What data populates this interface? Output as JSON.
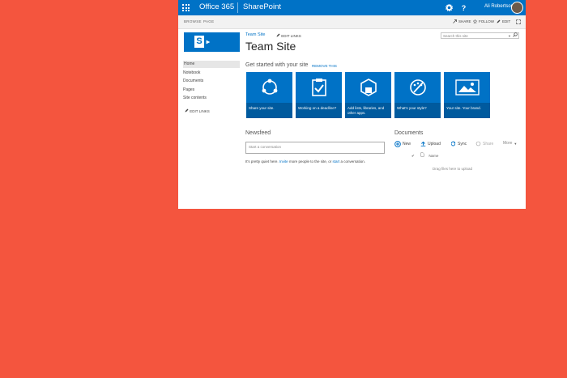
{
  "topbar": {
    "brand": "Office 365",
    "app": "SharePoint",
    "settings_icon": "gear-icon",
    "help_label": "?",
    "user_name": "Ali Robertson"
  },
  "ribbon": {
    "tabs": [
      "BROWSE",
      "PAGE"
    ],
    "share": "SHARE",
    "follow": "FOLLOW",
    "edit": "EDIT"
  },
  "site": {
    "logo_letter": "S",
    "breadcrumb": "Team Site",
    "edit_links": "EDIT LINKS",
    "title": "Team Site",
    "search_placeholder": "Search this site"
  },
  "nav": {
    "items": [
      "Home",
      "Notebook",
      "Documents",
      "Pages",
      "Site contents"
    ],
    "edit_links": "EDIT LINKS"
  },
  "getting_started": {
    "title": "Get started with your site",
    "remove": "REMOVE THIS",
    "tiles": [
      {
        "caption": "Share your site.",
        "icon": "share-icon"
      },
      {
        "caption": "Working on a deadline?",
        "icon": "clipboard-check-icon"
      },
      {
        "caption": "Add lists, libraries, and other apps.",
        "icon": "apps-icon"
      },
      {
        "caption": "What's your style?",
        "icon": "palette-icon"
      },
      {
        "caption": "Your site. Your brand.",
        "icon": "image-icon"
      }
    ]
  },
  "newsfeed": {
    "title": "Newsfeed",
    "placeholder": "Start a conversation",
    "quiet_prefix": "It's pretty quiet here.",
    "quiet_link1": "Invite",
    "quiet_middle": "more people to the site, or",
    "quiet_link2": "start",
    "quiet_suffix": "a conversation."
  },
  "documents": {
    "title": "Documents",
    "actions": [
      "New",
      "Upload",
      "Sync",
      "Share",
      "More"
    ],
    "column_name": "Name",
    "drop_text": "Drag files here to upload"
  },
  "colors": {
    "background": "#f4553e",
    "suite_bar": "#0072c6",
    "tile": "#0072c6"
  }
}
